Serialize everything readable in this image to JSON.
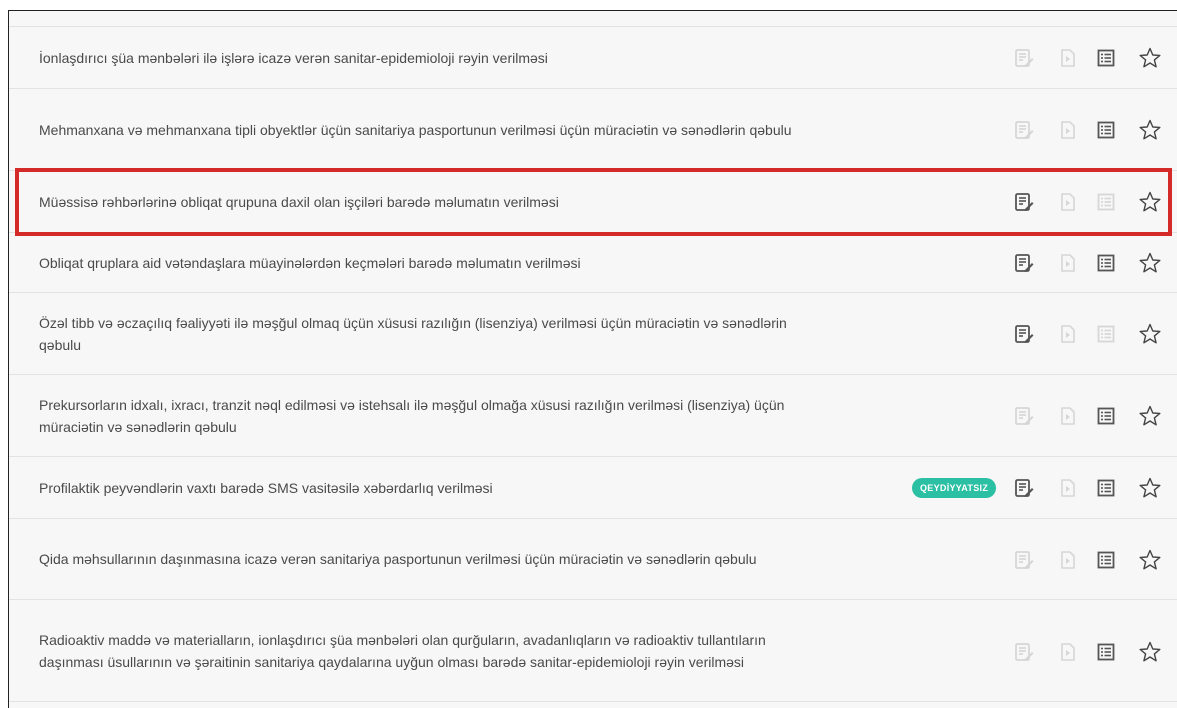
{
  "services": [
    {
      "title": "İonlaşdırıcı şüa mənbələri ilə işlərə icazə verən sanitar-epidemioloji rəyin verilməsi",
      "apply_active": false,
      "video_active": false,
      "info_active": true,
      "badge": ""
    },
    {
      "title": "Mehmanxana və mehmanxana tipli obyektlər üçün sanitariya pasportunun verilməsi üçün müraciətin və sənədlərin qəbulu",
      "apply_active": false,
      "video_active": false,
      "info_active": true,
      "badge": ""
    },
    {
      "title": "Müəssisə rəhbərlərinə obliqat qrupuna daxil olan işçiləri barədə məlumatın verilməsi",
      "apply_active": true,
      "video_active": false,
      "info_active": false,
      "badge": ""
    },
    {
      "title": "Obliqat qruplara aid vətəndaşlara müayinələrdən keçmələri barədə məlumatın verilməsi",
      "apply_active": true,
      "video_active": false,
      "info_active": true,
      "badge": ""
    },
    {
      "title": "Özəl tibb və əczaçılıq fəaliyyəti ilə məşğul olmaq üçün xüsusi razılığın (lisenziya) verilməsi üçün müraciətin və sənədlərin qəbulu",
      "apply_active": true,
      "video_active": false,
      "info_active": false,
      "badge": ""
    },
    {
      "title": "Prekursorların idxalı, ixracı, tranzit nəql edilməsi və istehsalı ilə məşğul olmağa xüsusi razılığın verilməsi (lisenziya) üçün müraciətin və sənədlərin qəbulu",
      "apply_active": false,
      "video_active": false,
      "info_active": true,
      "badge": ""
    },
    {
      "title": "Profilaktik peyvəndlərin vaxtı barədə SMS vasitəsilə xəbərdarlıq verilməsi",
      "apply_active": true,
      "video_active": false,
      "info_active": true,
      "badge": "QEYDİYYATSIZ"
    },
    {
      "title": "Qida məhsullarının daşınmasına icazə verən sanitariya pasportunun verilməsi üçün müraciətin və sənədlərin qəbulu",
      "apply_active": false,
      "video_active": false,
      "info_active": true,
      "badge": ""
    },
    {
      "title": "Radioaktiv maddə və materialların, ionlaşdırıcı şüa mənbələri olan qurğuların, avadanlıqların və radioaktiv tullantıların daşınması üsullarının və şəraitinin sanitariya qaydalarına uyğun olması barədə sanitar-epidemioloji rəyin verilməsi",
      "apply_active": false,
      "video_active": false,
      "info_active": true,
      "badge": ""
    }
  ],
  "colors": {
    "icon_active": "#555555",
    "icon_inactive": "#d6d6d6",
    "badge_bg": "#2bbfa4",
    "highlight": "#d42a2a"
  }
}
